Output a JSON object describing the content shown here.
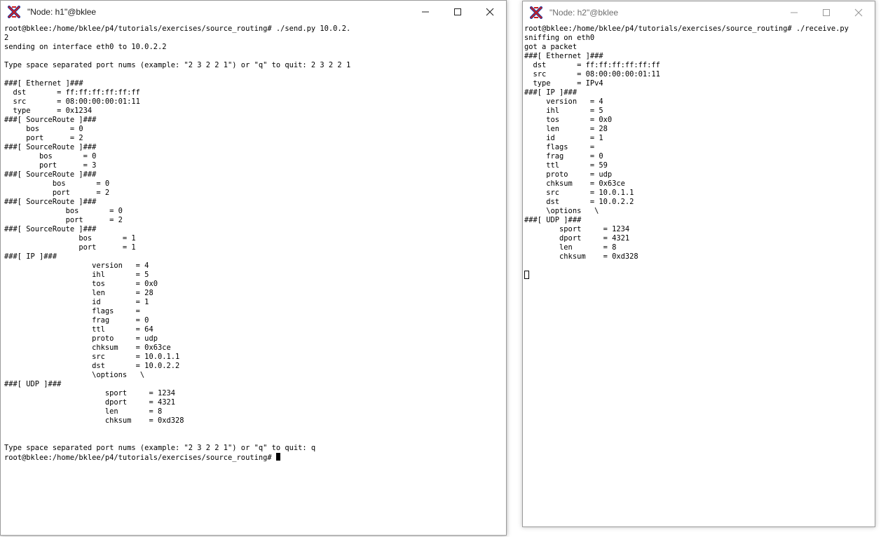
{
  "windows": {
    "h1": {
      "title": "\"Node: h1\"@bklee",
      "lines": [
        "root@bklee:/home/bklee/p4/tutorials/exercises/source_routing# ./send.py 10.0.2.",
        "2",
        "sending on interface eth0 to 10.0.2.2",
        "",
        "Type space separated port nums (example: \"2 3 2 2 1\") or \"q\" to quit: 2 3 2 2 1",
        "",
        "###[ Ethernet ]###",
        "  dst       = ff:ff:ff:ff:ff:ff",
        "  src       = 08:00:00:00:01:11",
        "  type      = 0x1234",
        "###[ SourceRoute ]###",
        "     bos       = 0",
        "     port      = 2",
        "###[ SourceRoute ]###",
        "        bos       = 0",
        "        port      = 3",
        "###[ SourceRoute ]###",
        "           bos       = 0",
        "           port      = 2",
        "###[ SourceRoute ]###",
        "              bos       = 0",
        "              port      = 2",
        "###[ SourceRoute ]###",
        "                 bos       = 1",
        "                 port      = 1",
        "###[ IP ]###",
        "                    version   = 4",
        "                    ihl       = 5",
        "                    tos       = 0x0",
        "                    len       = 28",
        "                    id        = 1",
        "                    flags     =",
        "                    frag      = 0",
        "                    ttl       = 64",
        "                    proto     = udp",
        "                    chksum    = 0x63ce",
        "                    src       = 10.0.1.1",
        "                    dst       = 10.0.2.2",
        "                    \\options   \\",
        "###[ UDP ]###",
        "                       sport     = 1234",
        "                       dport     = 4321",
        "                       len       = 8",
        "                       chksum    = 0xd328",
        "",
        "",
        "Type space separated port nums (example: \"2 3 2 2 1\") or \"q\" to quit: q"
      ],
      "prompt": "root@bklee:/home/bklee/p4/tutorials/exercises/source_routing# "
    },
    "h2": {
      "title": "\"Node: h2\"@bklee",
      "lines": [
        "root@bklee:/home/bklee/p4/tutorials/exercises/source_routing# ./receive.py",
        "sniffing on eth0",
        "got a packet",
        "###[ Ethernet ]###",
        "  dst       = ff:ff:ff:ff:ff:ff",
        "  src       = 08:00:00:00:01:11",
        "  type      = IPv4",
        "###[ IP ]###",
        "     version   = 4",
        "     ihl       = 5",
        "     tos       = 0x0",
        "     len       = 28",
        "     id        = 1",
        "     flags     =",
        "     frag      = 0",
        "     ttl       = 59",
        "     proto     = udp",
        "     chksum    = 0x63ce",
        "     src       = 10.0.1.1",
        "     dst       = 10.0.2.2",
        "     \\options   \\",
        "###[ UDP ]###",
        "        sport     = 1234",
        "        dport     = 4321",
        "        len       = 8",
        "        chksum    = 0xd328",
        ""
      ]
    }
  },
  "icons": {
    "app": "xterm-icon",
    "minimize": "minimize-icon",
    "maximize": "maximize-icon",
    "close": "close-icon"
  },
  "colors": {
    "xterm_red": "#cc1f1f",
    "xterm_blue": "#1f3fa8",
    "titlebar_inactive_text": "#6e6e6e"
  }
}
